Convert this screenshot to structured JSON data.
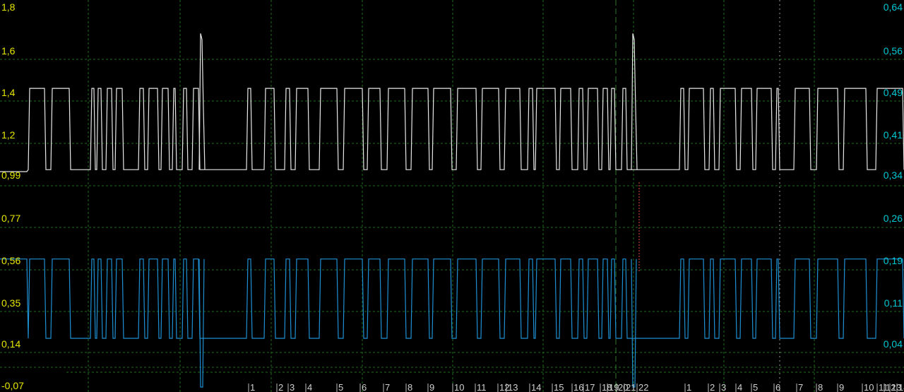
{
  "colors": {
    "background": "#000000",
    "grid": "#1f6b1f",
    "left_axis": "#e6e600",
    "right_axis": "#00c8d2",
    "channel_a": "#e8e8e8",
    "channel_b": "#1e8fd2",
    "cursor": "#e0e0e0",
    "marker": "#e04848"
  },
  "chart_data": {
    "type": "line",
    "title": "",
    "grid": true,
    "left_axis": {
      "ticks": [
        1.8,
        1.6,
        1.4,
        1.2,
        0.99,
        0.77,
        0.56,
        0.35,
        0.14,
        -0.07
      ],
      "labels": [
        "1,8",
        "1,6",
        "1,4",
        "1,2",
        "0,99",
        "0,77",
        "0,56",
        "0,35",
        "0,14",
        "-0,07"
      ],
      "ylim": [
        -0.07,
        1.8
      ]
    },
    "right_axis": {
      "labels": [
        "0,64",
        "0,56",
        "0,49",
        "0,41",
        "0,34",
        "0,26",
        "0,19",
        "0,11",
        "0,04"
      ]
    },
    "x_markers": [
      "1",
      "2",
      "3",
      "4",
      "5",
      "6",
      "7",
      "8",
      "9",
      "10",
      "11",
      "12",
      "13",
      "14",
      "15",
      "16",
      "17",
      "18",
      "19",
      "20",
      "21",
      "22",
      "1",
      "2",
      "3",
      "4",
      "5",
      "6",
      "7",
      "8",
      "9",
      "10",
      "11",
      "12",
      "13",
      "14"
    ],
    "series": [
      {
        "key": "channel_a",
        "low": 1.0,
        "high": 1.4,
        "spikes": [
          {
            "near_pulse": 6,
            "peak": 1.67
          },
          {
            "near_pulse": 22,
            "peak": 1.67
          }
        ]
      },
      {
        "key": "channel_b",
        "low": 0.17,
        "high": 0.56,
        "dips": [
          {
            "near_pulse": 6,
            "min": -0.07
          },
          {
            "near_pulse": 22,
            "min": -0.07
          }
        ]
      }
    ]
  }
}
